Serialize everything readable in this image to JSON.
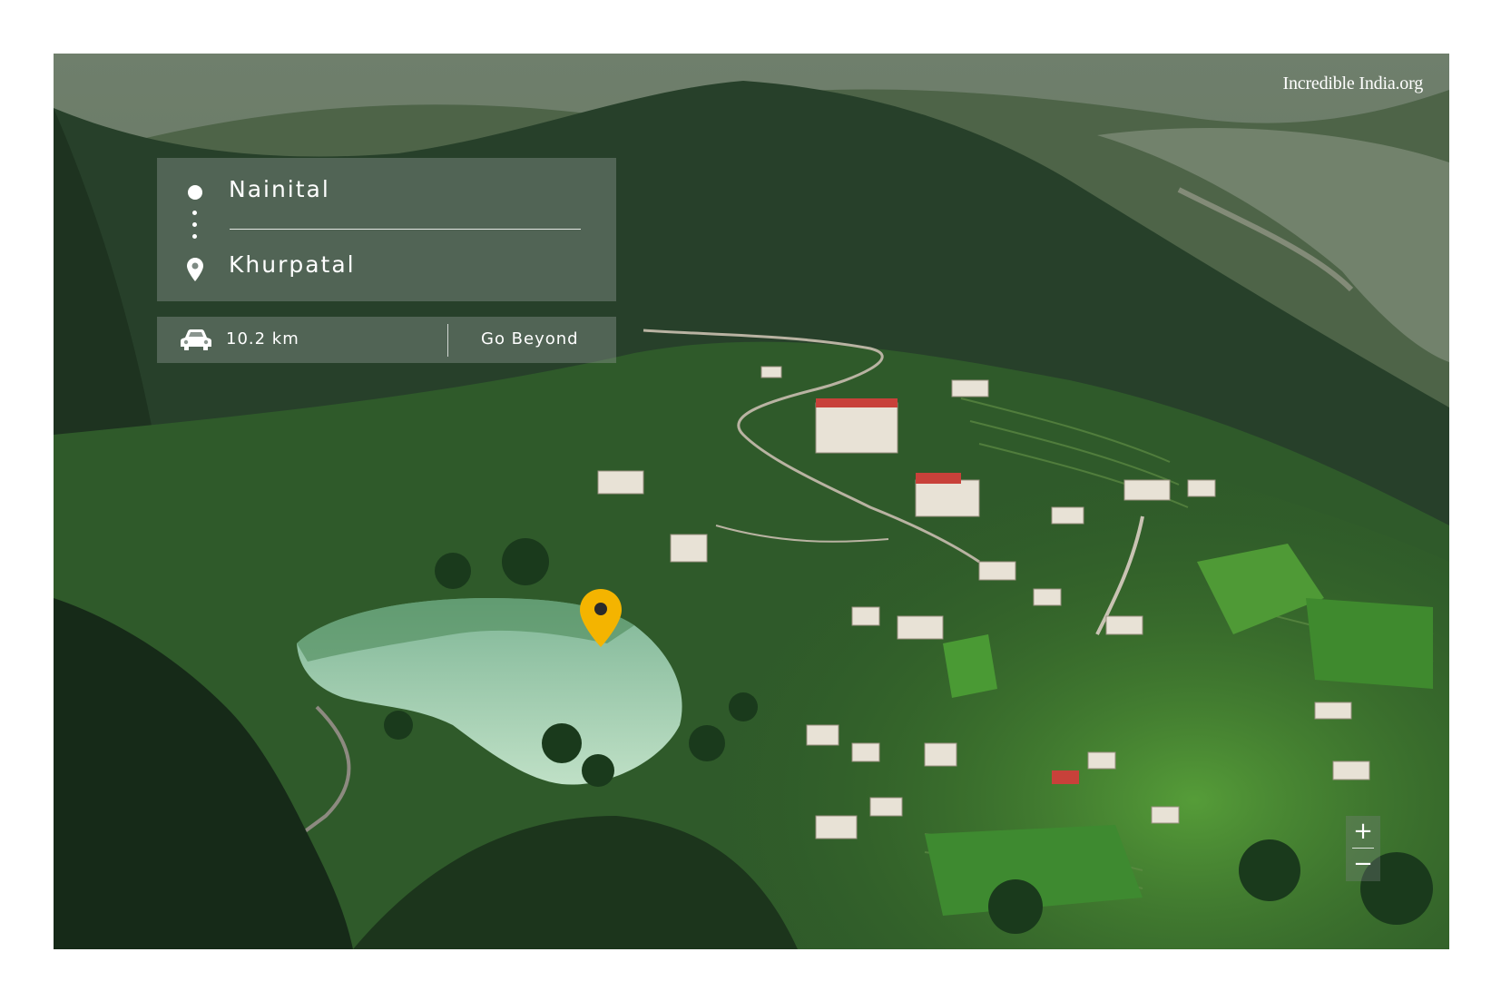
{
  "brand": {
    "text": "Incredible India.org",
    "accent_color": "#e53935"
  },
  "route": {
    "origin": "Nainital",
    "destination": "Khurpatal",
    "start_icon": "circle-dot-icon",
    "destination_icon": "map-pin-icon"
  },
  "trip": {
    "mode_icon": "car-icon",
    "distance": "10.2 km",
    "action_label": "Go Beyond"
  },
  "map": {
    "marker_icon": "location-pin-icon",
    "marker_color": "#f4b400",
    "zoom_in_label": "+",
    "zoom_out_label": "−"
  }
}
